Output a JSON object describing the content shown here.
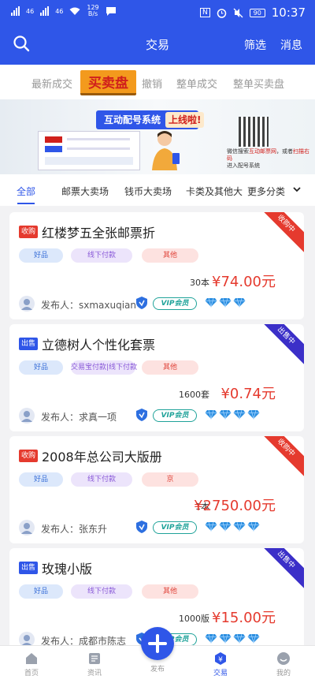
{
  "status": {
    "net_left": "46",
    "net_right": "46",
    "speed_value": "129",
    "speed_unit": "B/s",
    "nfc": "N",
    "battery": "90",
    "time": "10:37"
  },
  "header": {
    "title": "交易",
    "filter_label": "筛选",
    "message_label": "消息"
  },
  "order_tabs": [
    "最新成交",
    "买卖盘",
    "撤销",
    "整单成交",
    "整单买卖盘"
  ],
  "order_active_index": 1,
  "banner": {
    "system_label": "互动配号系统",
    "online_label": "上线啦!",
    "search_line_1": "微信搜索",
    "highlight_1": "互动邮票网",
    "search_line_2": "，或者",
    "highlight_2": "扫描右码",
    "enter_line": "进入配号系统",
    "form_labels": [
      "收购",
      "出售"
    ]
  },
  "category_tabs": [
    "全部",
    "邮票大卖场",
    "钱币大卖场",
    "卡类及其他大",
    "更多分类"
  ],
  "category_active_index": 0,
  "listings": [
    {
      "type_label": "收购",
      "type": "buy",
      "title": "红楼梦五全张邮票折",
      "grade": "好品",
      "payment": "线下付款",
      "other": "其他",
      "quantity": "30本",
      "price": "¥74.00元",
      "ribbon": "收购中",
      "publisher": "发布人：sxmaxuqian",
      "vip": "VIP会员",
      "diamonds": 3
    },
    {
      "type_label": "出售",
      "type": "sell",
      "title": "立德树人个性化套票",
      "grade": "好品",
      "payment": "交易宝付款|线下付款",
      "other": "其他",
      "quantity": "1600套",
      "price": "¥0.74元",
      "ribbon": "出售中",
      "publisher": "发布人：求真一项",
      "vip": "VIP会员",
      "diamonds": 4
    },
    {
      "type_label": "收购",
      "type": "buy",
      "title": "2008年总公司大版册",
      "grade": "好品",
      "payment": "线下付款",
      "other": "京",
      "quantity": "1本",
      "price": "¥2750.00元",
      "ribbon": "收购中",
      "publisher": "发布人：张东升",
      "vip": "VIP会员",
      "diamonds": 4
    },
    {
      "type_label": "出售",
      "type": "sell",
      "title": "玫瑰小版",
      "grade": "好品",
      "payment": "线下付款",
      "other": "其他",
      "quantity": "1000版",
      "price": "¥15.00元",
      "ribbon": "出售中",
      "publisher": "发布人：成都市陈志",
      "vip": "VIP会员",
      "diamonds": 4
    }
  ],
  "bottom_nav": [
    {
      "label": "首页",
      "icon": "home-icon"
    },
    {
      "label": "资讯",
      "icon": "news-icon"
    },
    {
      "label": "发布",
      "icon": "plus-icon"
    },
    {
      "label": "交易",
      "icon": "yen-icon"
    },
    {
      "label": "我的",
      "icon": "profile-icon"
    }
  ],
  "bottom_nav_active_index": 3,
  "colors": {
    "brand_blue": "#2f56e8",
    "buy_red": "#e53a2e",
    "sell_ribbon": "#3b2fc8",
    "vip_teal": "#20a39a"
  }
}
